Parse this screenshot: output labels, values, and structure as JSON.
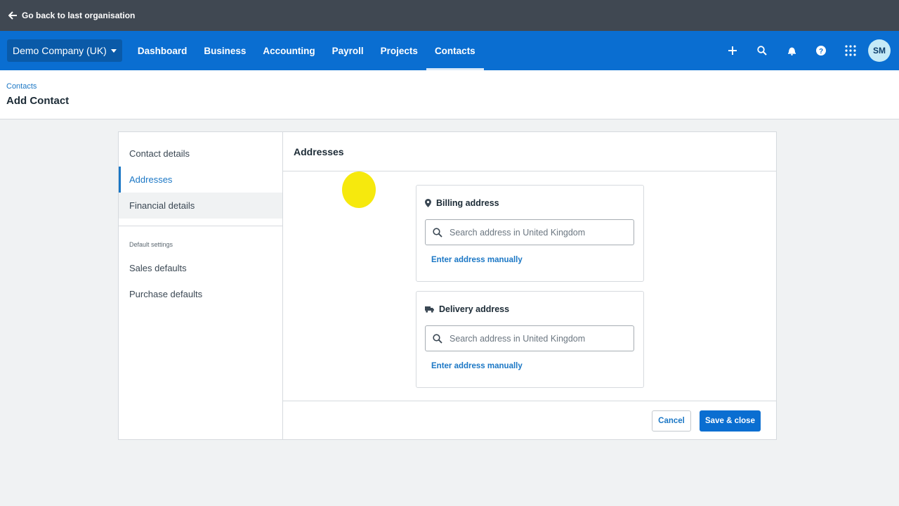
{
  "topbar": {
    "back_label": "Go back to last organisation"
  },
  "nav": {
    "org_name": "Demo Company (UK)",
    "items": [
      {
        "label": "Dashboard"
      },
      {
        "label": "Business"
      },
      {
        "label": "Accounting"
      },
      {
        "label": "Payroll"
      },
      {
        "label": "Projects"
      },
      {
        "label": "Contacts",
        "active": true
      }
    ],
    "avatar_initials": "SM",
    "icons": [
      "plus-icon",
      "search-icon",
      "bell-icon",
      "help-icon",
      "apps-grid-icon"
    ]
  },
  "page": {
    "breadcrumb": "Contacts",
    "title": "Add Contact"
  },
  "sidebar": {
    "items": [
      {
        "label": "Contact details"
      },
      {
        "label": "Addresses",
        "active": true
      },
      {
        "label": "Financial details"
      }
    ],
    "section_label": "Default settings",
    "settings_items": [
      {
        "label": "Sales defaults"
      },
      {
        "label": "Purchase defaults"
      }
    ]
  },
  "content": {
    "header": "Addresses",
    "billing": {
      "title": "Billing address",
      "icon": "map-pin-icon",
      "search_placeholder": "Search address in United Kingdom",
      "manual_link": "Enter address manually"
    },
    "delivery": {
      "title": "Delivery address",
      "icon": "truck-icon",
      "search_placeholder": "Search address in United Kingdom",
      "manual_link": "Enter address manually"
    },
    "cancel_label": "Cancel",
    "save_label": "Save & close"
  },
  "colors": {
    "topbar": "#404852",
    "nav": "#0a6ed1",
    "accent": "#1b77c5",
    "cursor_highlight": "#f5e800"
  }
}
